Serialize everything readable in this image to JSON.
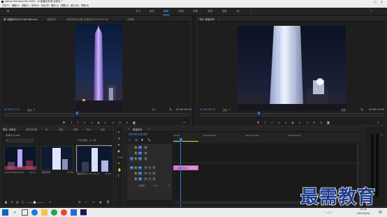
{
  "app": {
    "title": "Adobe Premiere Pro 2020 - D:\\新建文件夹\\未命名 *",
    "menu": [
      "文件(F)",
      "编辑(E)",
      "剪辑(C)",
      "序列(S)",
      "标记(M)",
      "图形(G)",
      "视图(V)",
      "窗口(W)",
      "帮助(H)"
    ]
  },
  "workspaces": {
    "items": [
      "学习",
      "组件",
      "编辑",
      "颜色",
      "效果",
      "音频",
      "图形",
      "库"
    ],
    "active": "编辑",
    "more": "»"
  },
  "source_panel": {
    "tabs": [
      "源: 新建序列(20210624)B.mp4",
      "效果控件",
      "音频剪辑混合器: 新建序列(20210624)B",
      "元数据"
    ],
    "timecode_left": "00:00:11:21",
    "fit": "适合",
    "fraction": "1/2",
    "timecode_right": "00:00:16:20"
  },
  "program_panel": {
    "tabs": [
      "节目: 新建序列"
    ],
    "timecode_left": "00:00:03:05",
    "fit": "适合",
    "fraction": "完整",
    "timecode_right": "00:00:15:00"
  },
  "project_panel": {
    "tabs": [
      "项目: 未命名",
      "媒体浏览器",
      "库",
      "信息",
      "效果",
      "标记",
      "历史"
    ],
    "project_file": "未命名.prproj",
    "item_count": "1 项已选择，共 4 项",
    "clips": [
      {
        "name": "(20210624)B.mp4",
        "duration": "16:20"
      },
      {
        "name": "新建序列",
        "duration": "15:00"
      },
      {
        "name": "新建序列 01_01_01_01",
        "duration": "16:20"
      }
    ]
  },
  "timeline": {
    "tab": "新建序列",
    "timecode": "00:00:03:05",
    "ruler": [
      "00:00",
      "00:00:05:00",
      "00:00:10:00",
      "00:00:15:00"
    ],
    "video_tracks": [
      "V3",
      "V2",
      "V1"
    ],
    "audio_tracks": [
      "A1",
      "A2",
      "A3"
    ],
    "master": "主声道",
    "master_value": "0.0",
    "clip_label": "fx 新建序列(V)"
  },
  "watermark": "最需教育",
  "taskbar": {
    "time": "19:40",
    "date": "2021/6/24"
  },
  "colors": {
    "accent": "#4a9bff",
    "clip": "#e08ee0",
    "playhead": "#2f7bd6"
  }
}
